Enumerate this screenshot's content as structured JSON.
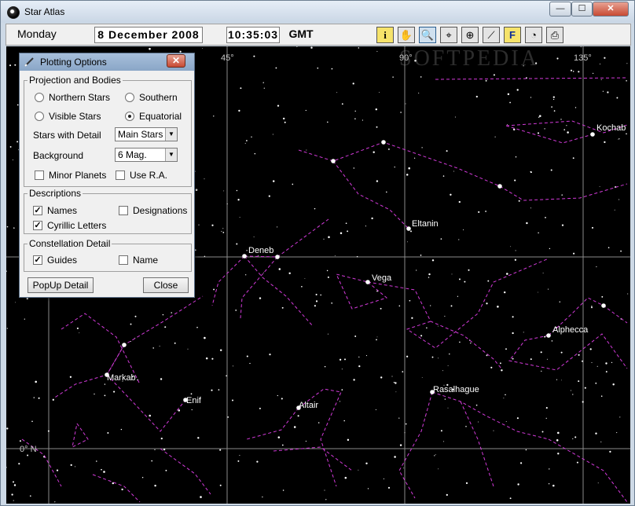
{
  "window": {
    "title": "Star Atlas",
    "controls": {
      "minimize": "—",
      "maximize": "☐",
      "close": "✕"
    }
  },
  "toolbar": {
    "day": "Monday",
    "date": "8  December  2008",
    "time": "10:35:03",
    "timezone": "GMT",
    "tools": [
      {
        "name": "info-icon",
        "glyph": "i"
      },
      {
        "name": "hand-icon",
        "glyph": "✋"
      },
      {
        "name": "zoom-icon",
        "glyph": "🔍"
      },
      {
        "name": "center-target-icon",
        "glyph": "⌖"
      },
      {
        "name": "locate-target-icon",
        "glyph": "⊕"
      },
      {
        "name": "telescope-icon",
        "glyph": "⟋"
      },
      {
        "name": "find-icon",
        "glyph": "F"
      },
      {
        "name": "clock-icon",
        "glyph": "◔"
      },
      {
        "name": "print-icon",
        "glyph": "⎙"
      }
    ]
  },
  "map": {
    "watermark": "SOFTPEDIA",
    "ra_labels": [
      "45°",
      "90°",
      "135°"
    ],
    "dec_labels": [
      "0° N"
    ],
    "star_labels": [
      "Kochab",
      "Eltanin",
      "Deneb",
      "Vega",
      "Alphecca",
      "Markab",
      "Enif",
      "Altair",
      "Rasalhague"
    ],
    "colors": {
      "background": "#000000",
      "constellation_lines": "#d23ad9",
      "grid": "#8a8a8a",
      "stars": "#ffffff"
    }
  },
  "dialog": {
    "title": "Plotting Options",
    "close": "✕",
    "projection": {
      "label": "Projection  and Bodies",
      "northern": "Northern Stars",
      "southern": "Southern",
      "visible": "Visible Stars",
      "equatorial": "Equatorial",
      "selected": "Equatorial",
      "stars_detail_label": "Stars with Detail",
      "stars_detail_value": "Main Stars",
      "background_label": "Background",
      "background_value": "6   Mag.",
      "minor_planets": "Minor Planets",
      "use_ra": "Use R.A."
    },
    "descriptions": {
      "label": "Descriptions",
      "names": "Names",
      "designations": "Designations",
      "cyrillic": "Cyrillic Letters"
    },
    "constellation": {
      "label": "Constellation Detail",
      "guides": "Guides",
      "name": "Name"
    },
    "buttons": {
      "popup": "PopUp Detail",
      "close": "Close"
    },
    "checks": {
      "minor_planets": false,
      "use_ra": false,
      "names": true,
      "designations": false,
      "cyrillic": true,
      "guides": true,
      "name": false
    }
  }
}
